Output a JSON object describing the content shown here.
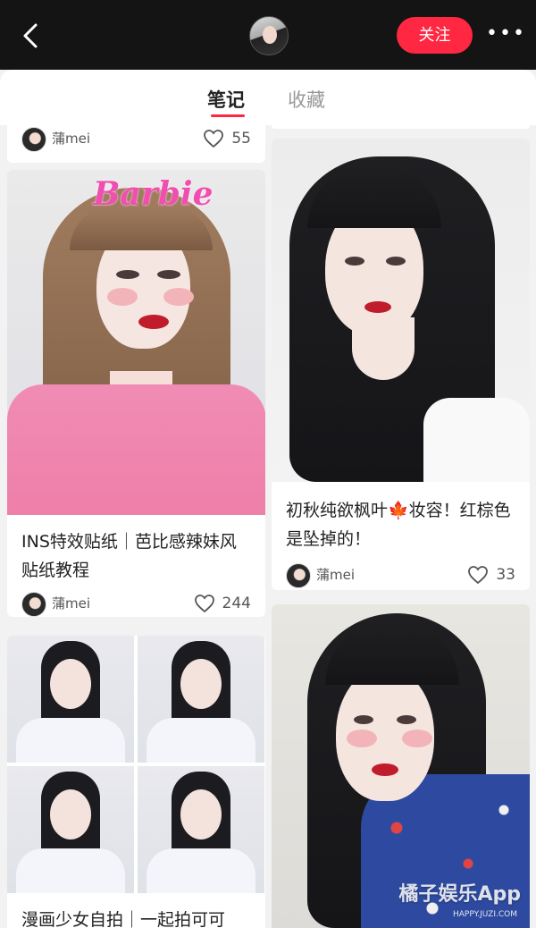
{
  "header": {
    "follow_label": "关注",
    "more_label": "•••"
  },
  "tabs": [
    {
      "label": "笔记",
      "active": true
    },
    {
      "label": "收藏",
      "active": false
    }
  ],
  "accent_color": "#ff2741",
  "feed": {
    "left": [
      {
        "author": "蒲mei",
        "likes": "55",
        "title": ""
      },
      {
        "author": "蒲mei",
        "likes": "244",
        "title": "INS特效贴纸｜芭比感辣妹风贴纸教程",
        "sticker_text": "Barbie"
      },
      {
        "author": "",
        "likes": "",
        "title": "漫画少女自拍｜一起拍可可"
      }
    ],
    "right": [
      {
        "author": "蒲mei",
        "likes": "33",
        "title": "初秋纯欲枫叶🍁妆容！红棕色是坠掉的！"
      },
      {
        "author": "",
        "likes": "",
        "title": ""
      }
    ]
  },
  "watermark": {
    "main": "橘子娱乐App",
    "sub": "HAPPY.JUZI.COM"
  }
}
